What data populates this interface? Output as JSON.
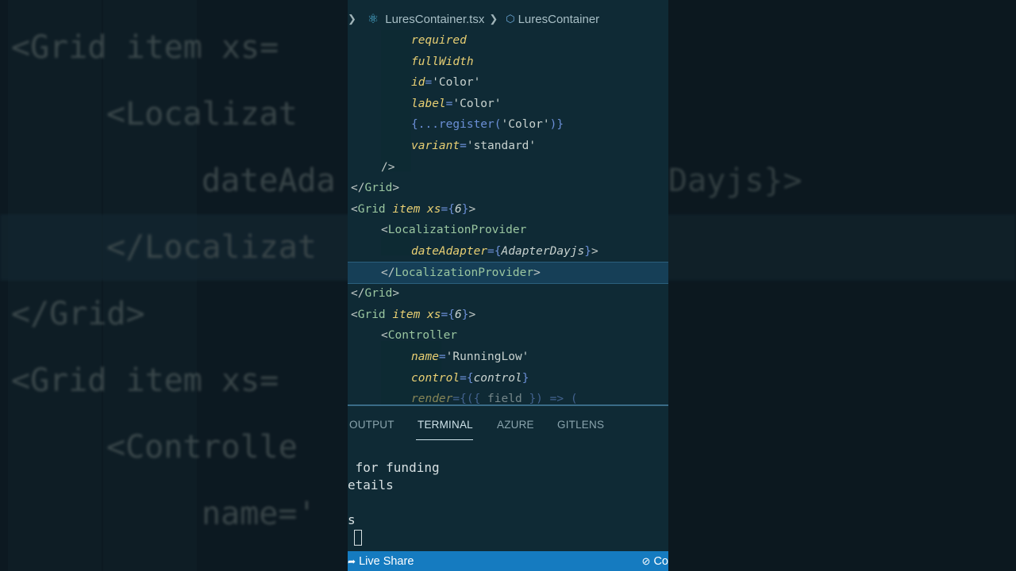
{
  "breadcrumb": {
    "file": "LuresContainer.tsx",
    "symbol": "LuresContainer"
  },
  "code_lines": [
    {
      "indent": 2,
      "parts": [
        [
          "attr",
          "required"
        ]
      ]
    },
    {
      "indent": 2,
      "parts": [
        [
          "attr",
          "fullWidth"
        ]
      ]
    },
    {
      "indent": 2,
      "parts": [
        [
          "attr",
          "id"
        ],
        [
          "eq",
          "="
        ],
        [
          "str",
          "'Color'"
        ]
      ]
    },
    {
      "indent": 2,
      "parts": [
        [
          "attr",
          "label"
        ],
        [
          "eq",
          "="
        ],
        [
          "str",
          "'Color'"
        ]
      ]
    },
    {
      "indent": 2,
      "parts": [
        [
          "curly",
          "{...register("
        ],
        [
          "str",
          "'Color'"
        ],
        [
          "curly",
          ")}"
        ]
      ]
    },
    {
      "indent": 2,
      "parts": [
        [
          "attr",
          "variant"
        ],
        [
          "eq",
          "="
        ],
        [
          "str",
          "'standard'"
        ]
      ]
    },
    {
      "indent": 1,
      "parts": [
        [
          "brk",
          "/>"
        ]
      ]
    },
    {
      "indent": 0,
      "parts": [
        [
          "brk",
          "</"
        ],
        [
          "tag",
          "Grid"
        ],
        [
          "brk",
          ">"
        ]
      ]
    },
    {
      "indent": 0,
      "parts": [
        [
          "brk",
          "<"
        ],
        [
          "tag",
          "Grid "
        ],
        [
          "attr",
          "item xs"
        ],
        [
          "eq",
          "="
        ],
        [
          "curly",
          "{"
        ],
        [
          "num",
          "6"
        ],
        [
          "curly",
          "}"
        ],
        [
          "brk",
          ">"
        ]
      ]
    },
    {
      "indent": 1,
      "parts": [
        [
          "brk",
          "<"
        ],
        [
          "tag",
          "LocalizationProvider"
        ]
      ]
    },
    {
      "indent": 2,
      "parts": [
        [
          "attr",
          "dateAdapter"
        ],
        [
          "eq",
          "="
        ],
        [
          "curly",
          "{"
        ],
        [
          "num",
          "AdapterDayjs"
        ],
        [
          "curly",
          "}"
        ],
        [
          "brk",
          ">"
        ]
      ]
    },
    {
      "indent": 1,
      "parts": [
        [
          "brk",
          "</"
        ],
        [
          "tag",
          "LocalizationProvider"
        ],
        [
          "brk",
          ">"
        ]
      ],
      "current": true
    },
    {
      "indent": 0,
      "parts": [
        [
          "brk",
          "</"
        ],
        [
          "tag",
          "Grid"
        ],
        [
          "brk",
          ">"
        ]
      ]
    },
    {
      "indent": 0,
      "parts": [
        [
          "brk",
          "<"
        ],
        [
          "tag",
          "Grid "
        ],
        [
          "attr",
          "item xs"
        ],
        [
          "eq",
          "="
        ],
        [
          "curly",
          "{"
        ],
        [
          "num",
          "6"
        ],
        [
          "curly",
          "}"
        ],
        [
          "brk",
          ">"
        ]
      ]
    },
    {
      "indent": 1,
      "parts": [
        [
          "brk",
          "<"
        ],
        [
          "tag",
          "Controller"
        ]
      ]
    },
    {
      "indent": 2,
      "parts": [
        [
          "attr",
          "name"
        ],
        [
          "eq",
          "="
        ],
        [
          "str",
          "'RunningLow'"
        ]
      ]
    },
    {
      "indent": 2,
      "parts": [
        [
          "attr",
          "control"
        ],
        [
          "eq",
          "="
        ],
        [
          "curly",
          "{"
        ],
        [
          "num",
          "control"
        ],
        [
          "curly",
          "}"
        ]
      ]
    },
    {
      "indent": 2,
      "parts": [
        [
          "attr",
          "render"
        ],
        [
          "eq",
          "="
        ],
        [
          "curly",
          "{({ "
        ],
        [
          "str",
          "field "
        ],
        [
          "curly",
          "}) => ("
        ]
      ],
      "dim": true
    }
  ],
  "panel": {
    "tabs": [
      "OUTPUT",
      "TERMINAL",
      "AZURE",
      "GITLENS"
    ],
    "active_tab": "TERMINAL"
  },
  "terminal": {
    "lines": [
      " for funding",
      "etails",
      "",
      "s"
    ]
  },
  "statusbar": {
    "live_share": "Live Share",
    "right_text": "Co"
  },
  "background": {
    "rows": [
      {
        "text": "<Grid item xs=",
        "indent": 0
      },
      {
        "text": "<Localizat",
        "indent": 1
      },
      {
        "text": "dateAda",
        "indent": 2,
        "right": "Dayjs}>"
      },
      {
        "text": "</Localizat",
        "indent": 1,
        "hl": true
      },
      {
        "text": "</Grid>",
        "indent": 0
      },
      {
        "text": "<Grid item xs=",
        "indent": 0
      },
      {
        "text": "<Controlle",
        "indent": 1
      },
      {
        "text": "name='",
        "indent": 2
      }
    ]
  },
  "colors": {
    "editor_bg": "#0f2a35",
    "status_bar": "#157bc0",
    "tag": "#9ac6a0",
    "attribute": "#e8cf73",
    "punctuation": "#6b8fd6"
  }
}
